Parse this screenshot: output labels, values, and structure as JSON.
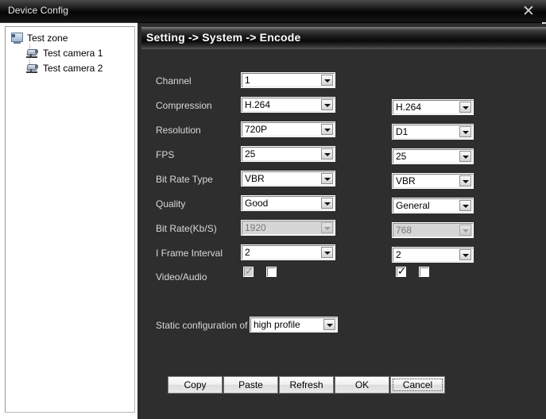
{
  "window": {
    "title": "Device Config",
    "close_label": "✕"
  },
  "tree": {
    "nodes": [
      {
        "label": "Test zone",
        "icon": "zone-icon",
        "level": 0
      },
      {
        "label": "Test camera 1",
        "icon": "camera-icon",
        "level": 1
      },
      {
        "label": "Test camera 2",
        "icon": "camera-icon",
        "level": 1
      }
    ]
  },
  "main": {
    "header": "Setting -> System -> Encode",
    "rows": [
      {
        "label": "Channel",
        "main_value": "1",
        "sub_value": null,
        "main_disabled": false,
        "sub_disabled": false
      },
      {
        "label": "Compression",
        "main_value": "H.264",
        "sub_value": "H.264",
        "main_disabled": false,
        "sub_disabled": false
      },
      {
        "label": "Resolution",
        "main_value": "720P",
        "sub_value": "D1",
        "main_disabled": false,
        "sub_disabled": false
      },
      {
        "label": "FPS",
        "main_value": "25",
        "sub_value": "25",
        "main_disabled": false,
        "sub_disabled": false
      },
      {
        "label": "Bit Rate Type",
        "main_value": "VBR",
        "sub_value": "VBR",
        "main_disabled": false,
        "sub_disabled": false
      },
      {
        "label": "Quality",
        "main_value": "Good",
        "sub_value": "General",
        "main_disabled": false,
        "sub_disabled": false
      },
      {
        "label": "Bit Rate(Kb/S)",
        "main_value": "1920",
        "sub_value": "768",
        "main_disabled": true,
        "sub_disabled": true
      },
      {
        "label": "I Frame Interval",
        "main_value": "2",
        "sub_value": "2",
        "main_disabled": false,
        "sub_disabled": false
      }
    ],
    "video_audio": {
      "label": "Video/Audio",
      "main_video_checked": true,
      "main_video_dim": true,
      "main_audio_checked": false,
      "sub_video_checked": true,
      "sub_video_dim": false,
      "sub_audio_checked": false
    },
    "static_config": {
      "label": "Static configuration of",
      "value": "high profile"
    },
    "buttons": [
      {
        "label": "Copy",
        "focused": false
      },
      {
        "label": "Paste",
        "focused": false
      },
      {
        "label": "Refresh",
        "focused": false
      },
      {
        "label": "OK",
        "focused": false
      },
      {
        "label": "Cancel",
        "focused": true
      }
    ]
  }
}
